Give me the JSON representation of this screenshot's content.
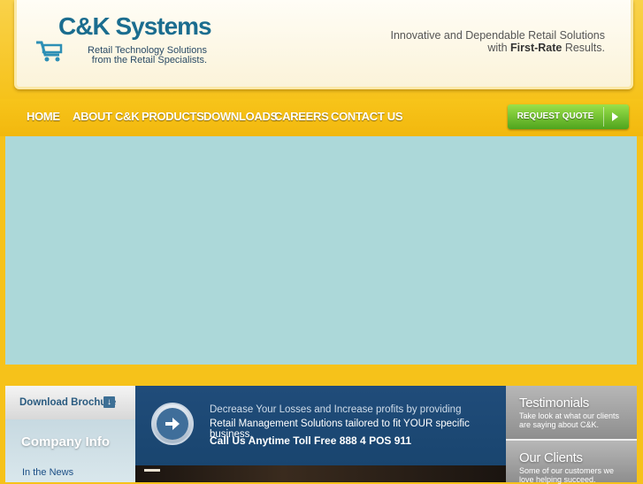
{
  "header": {
    "logo_main": "C&K Systems",
    "logo_sub_line1": "Retail Technology Solutions",
    "logo_sub_line2": "from the Retail Specialists.",
    "tagline_line1": "Innovative and Dependable Retail Solutions",
    "tagline_line2_prefix": "with ",
    "tagline_line2_bold": "First-Rate",
    "tagline_line2_suffix": " Results."
  },
  "nav": {
    "items": [
      "HOME",
      "ABOUT C&K",
      "PRODUCTS",
      "DOWNLOADS",
      "CAREERS",
      "CONTACT US"
    ],
    "quote_button": "REQUEST QUOTE"
  },
  "sidebar": {
    "brochure": "Download Brochure",
    "company_title": "Company Info",
    "company_items": [
      "In the News"
    ]
  },
  "promo": {
    "line1": "Decrease Your Losses and Increase profits by providing",
    "line2": "Retail Management Solutions tailored to fit YOUR specific business.",
    "line3": "Call Us Anytime Toll Free  888 4 POS 911"
  },
  "cards": {
    "testimonials_title": "Testimonials",
    "testimonials_desc": "Take look at what our clients are saying about C&K.",
    "clients_title": "Our Clients",
    "clients_desc": "Some of our customers we love helping succeed."
  },
  "colors": {
    "brand_yellow": "#f6c21a",
    "banner": "#acd8d9",
    "promo_blue": "#1e4a76",
    "quote_green": "#6cbf2c"
  }
}
